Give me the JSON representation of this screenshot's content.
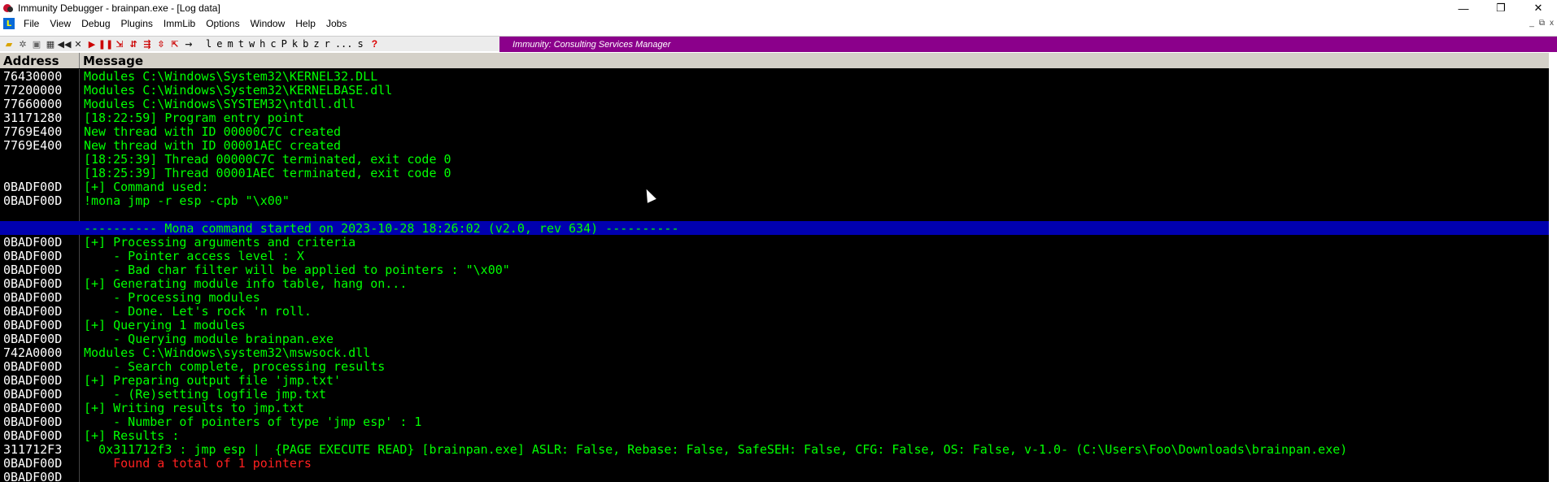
{
  "window": {
    "title": "Immunity Debugger - brainpan.exe - [Log data]",
    "controls": [
      "—",
      "❐",
      "✕"
    ]
  },
  "menu": {
    "items": [
      "File",
      "View",
      "Debug",
      "Plugins",
      "ImmLib",
      "Options",
      "Window",
      "Help",
      "Jobs"
    ],
    "mdi_controls": [
      "_",
      "⧉",
      "x"
    ]
  },
  "toolbar": {
    "letters": [
      "l",
      "e",
      "m",
      "t",
      "w",
      "h",
      "c",
      "P",
      "k",
      "b",
      "z",
      "r",
      "...",
      "s"
    ],
    "help": "?",
    "banner": "Immunity: Consulting Services Manager"
  },
  "log": {
    "header": {
      "address": "Address",
      "message": "Message"
    },
    "rows": [
      {
        "addr": "76430000",
        "msg": "Modules C:\\Windows\\System32\\KERNEL32.DLL",
        "style": "green"
      },
      {
        "addr": "77200000",
        "msg": "Modules C:\\Windows\\System32\\KERNELBASE.dll",
        "style": "green"
      },
      {
        "addr": "77660000",
        "msg": "Modules C:\\Windows\\SYSTEM32\\ntdll.dll",
        "style": "green"
      },
      {
        "addr": "31171280",
        "msg": "[18:22:59] Program entry point",
        "style": "green"
      },
      {
        "addr": "7769E400",
        "msg": "New thread with ID 00000C7C created",
        "style": "green"
      },
      {
        "addr": "7769E400",
        "msg": "New thread with ID 00001AEC created",
        "style": "green"
      },
      {
        "addr": "",
        "msg": "[18:25:39] Thread 00000C7C terminated, exit code 0",
        "style": "green"
      },
      {
        "addr": "",
        "msg": "[18:25:39] Thread 00001AEC terminated, exit code 0",
        "style": "green"
      },
      {
        "addr": "0BADF00D",
        "msg": "[+] Command used:",
        "style": "green"
      },
      {
        "addr": "0BADF00D",
        "msg": "!mona jmp -r esp -cpb \"\\x00\"",
        "style": "green"
      },
      {
        "addr": "",
        "msg": "",
        "style": "green"
      },
      {
        "addr": "",
        "msg": "---------- Mona command started on 2023-10-28 18:26:02 (v2.0, rev 634) ----------",
        "style": "blue"
      },
      {
        "addr": "0BADF00D",
        "msg": "[+] Processing arguments and criteria",
        "style": "green"
      },
      {
        "addr": "0BADF00D",
        "msg": "    - Pointer access level : X",
        "style": "green"
      },
      {
        "addr": "0BADF00D",
        "msg": "    - Bad char filter will be applied to pointers : \"\\x00\"",
        "style": "green"
      },
      {
        "addr": "0BADF00D",
        "msg": "[+] Generating module info table, hang on...",
        "style": "green"
      },
      {
        "addr": "0BADF00D",
        "msg": "    - Processing modules",
        "style": "green"
      },
      {
        "addr": "0BADF00D",
        "msg": "    - Done. Let's rock 'n roll.",
        "style": "green"
      },
      {
        "addr": "0BADF00D",
        "msg": "[+] Querying 1 modules",
        "style": "green"
      },
      {
        "addr": "0BADF00D",
        "msg": "    - Querying module brainpan.exe",
        "style": "green"
      },
      {
        "addr": "742A0000",
        "msg": "Modules C:\\Windows\\system32\\mswsock.dll",
        "style": "green"
      },
      {
        "addr": "0BADF00D",
        "msg": "    - Search complete, processing results",
        "style": "green"
      },
      {
        "addr": "0BADF00D",
        "msg": "[+] Preparing output file 'jmp.txt'",
        "style": "green"
      },
      {
        "addr": "0BADF00D",
        "msg": "    - (Re)setting logfile jmp.txt",
        "style": "green"
      },
      {
        "addr": "0BADF00D",
        "msg": "[+] Writing results to jmp.txt",
        "style": "green"
      },
      {
        "addr": "0BADF00D",
        "msg": "    - Number of pointers of type 'jmp esp' : 1",
        "style": "green"
      },
      {
        "addr": "0BADF00D",
        "msg": "[+] Results :",
        "style": "green"
      },
      {
        "addr": "311712F3",
        "msg": "  0x311712f3 : jmp esp |  {PAGE_EXECUTE_READ} [brainpan.exe] ASLR: False, Rebase: False, SafeSEH: False, CFG: False, OS: False, v-1.0- (C:\\Users\\Foo\\Downloads\\brainpan.exe)",
        "style": "green"
      },
      {
        "addr": "0BADF00D",
        "msg": "    Found a total of 1 pointers",
        "style": "red"
      },
      {
        "addr": "0BADF00D",
        "msg": "",
        "style": "green"
      }
    ]
  }
}
